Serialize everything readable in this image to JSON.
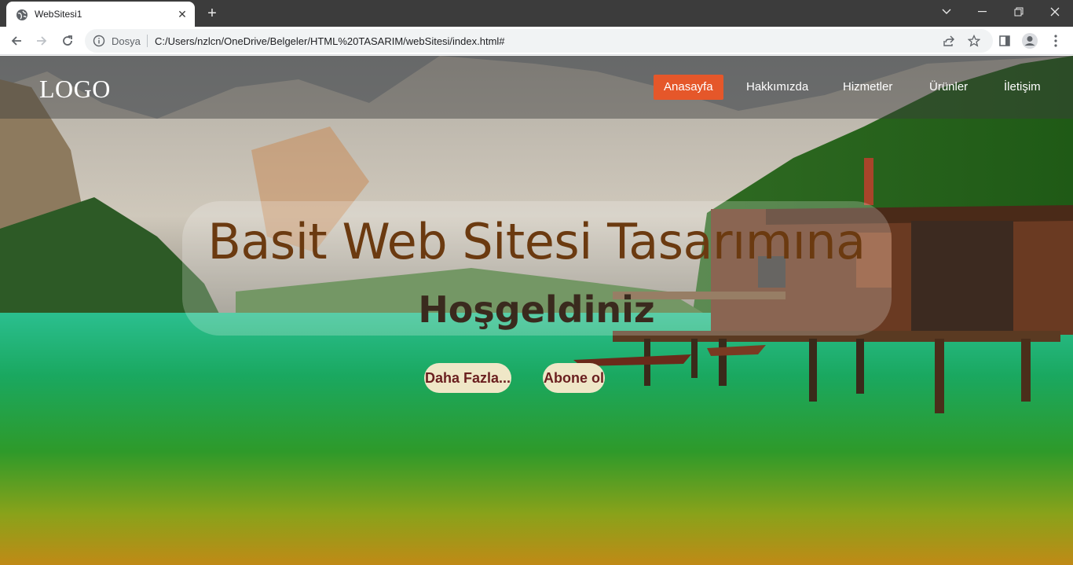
{
  "browser": {
    "tab_title": "WebSitesi1",
    "scheme_label": "Dosya",
    "url": "C:/Users/nzlcn/OneDrive/Belgeler/HTML%20TASARIM/webSitesi/index.html#"
  },
  "site": {
    "logo": "LOGO",
    "menu": [
      {
        "label": "Anasayfa"
      },
      {
        "label": "Hakkımızda"
      },
      {
        "label": "Hizmetler"
      },
      {
        "label": "Ürünler"
      },
      {
        "label": "İletişim"
      }
    ],
    "hero_title": "Basit Web Sitesi Tasarımına",
    "hero_subtitle": "Hoşgeldiniz",
    "buttons": {
      "more": "Daha Fazla...",
      "subscribe": "Abone ol"
    }
  },
  "colors": {
    "active_menu": "#e5572a",
    "title_color": "#6b3a10",
    "button_bg": "#efe7c7",
    "button_text": "#6a1f1f"
  }
}
